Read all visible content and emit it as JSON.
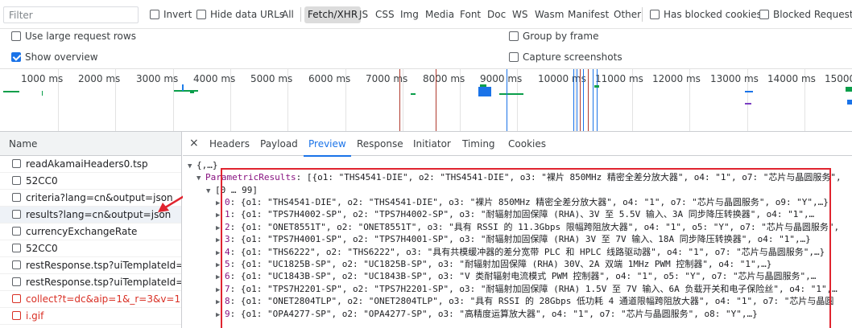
{
  "filter": {
    "placeholder": "Filter",
    "invert_label": "Invert",
    "hide_data_urls_label": "Hide data URLs",
    "types": [
      "All",
      "Fetch/XHR",
      "JS",
      "CSS",
      "Img",
      "Media",
      "Font",
      "Doc",
      "WS",
      "Wasm",
      "Manifest",
      "Other"
    ],
    "active_type": "Fetch/XHR",
    "has_blocked_cookies_label": "Has blocked cookies",
    "blocked_requests_label": "Blocked Requests"
  },
  "options": {
    "large_rows_label": "Use large request rows",
    "show_overview_label": "Show overview",
    "group_by_frame_label": "Group by frame",
    "capture_screenshots_label": "Capture screenshots"
  },
  "overview": {
    "ticks": [
      "1000 ms",
      "2000 ms",
      "3000 ms",
      "4000 ms",
      "5000 ms",
      "6000 ms",
      "7000 ms",
      "8000 ms",
      "9000 ms",
      "10000 ms",
      "11000 ms",
      "12000 ms",
      "13000 ms",
      "14000 ms",
      "15000 ms",
      "16000"
    ]
  },
  "request_list": {
    "header": "Name",
    "rows": [
      {
        "name": "readAkamaiHeaders0.tsp",
        "error": false
      },
      {
        "name": "52CC0",
        "error": false
      },
      {
        "name": "criteria?lang=cn&output=json",
        "error": false
      },
      {
        "name": "results?lang=cn&output=json",
        "error": false
      },
      {
        "name": "currencyExchangeRate",
        "error": false
      },
      {
        "name": "52CC0",
        "error": false
      },
      {
        "name": "restResponse.tsp?uiTemplateId=R...",
        "error": false
      },
      {
        "name": "restResponse.tsp?uiTemplateId=R...",
        "error": false
      },
      {
        "name": "collect?t=dc&aip=1&_r=3&v=1&...",
        "error": true
      },
      {
        "name": "i.gif",
        "error": true
      }
    ]
  },
  "details": {
    "close_label": "×",
    "tabs": [
      "Headers",
      "Payload",
      "Preview",
      "Response",
      "Initiator",
      "Timing",
      "Cookies"
    ],
    "active_tab": "Preview",
    "preview": {
      "root": "{,…}",
      "param_key": "ParametricResults",
      "param_summary": ": [{o1: \"THS4541-DIE\", o2: \"THS4541-DIE\", o3: \"裸片 850MHz 精密全差分放大器\", o4: \"1\", o7: \"芯片与晶圆服务\",",
      "range": "[0 … 99]",
      "items": [
        {
          "i": "0",
          "text": ": {o1: \"THS4541-DIE\", o2: \"THS4541-DIE\", o3: \"裸片 850MHz 精密全差分放大器\", o4: \"1\", o7: \"芯片与晶圆服务\", o9: \"Y\",…}"
        },
        {
          "i": "1",
          "text": ": {o1: \"TPS7H4002-SP\", o2: \"TPS7H4002-SP\", o3: \"耐辐射加固保障 (RHA)、3V 至 5.5V 输入、3A 同步降压转换器\", o4: \"1\",…"
        },
        {
          "i": "2",
          "text": ": {o1: \"ONET8551T\", o2: \"ONET8551T\", o3: \"具有 RSSI 的 11.3Gbps 限幅跨阻放大器\", o4: \"1\", o5: \"Y\", o7: \"芯片与晶圆服务\","
        },
        {
          "i": "3",
          "text": ": {o1: \"TPS7H4001-SP\", o2: \"TPS7H4001-SP\", o3: \"耐辐射加固保障 (RHA) 3V 至 7V 输入、18A 同步降压转换器\", o4: \"1\",…}"
        },
        {
          "i": "4",
          "text": ": {o1: \"THS6222\", o2: \"THS6222\", o3: \"具有共模缓冲器的差分宽带 PLC 和 HPLC 线路驱动器\", o4: \"1\", o7: \"芯片与晶圆服务\",…}"
        },
        {
          "i": "5",
          "text": ": {o1: \"UC1825B-SP\", o2: \"UC1825B-SP\", o3: \"耐辐射加固保障 (RHA) 30V、2A 双端 1MHz PWM 控制器\", o4: \"1\",…}"
        },
        {
          "i": "6",
          "text": ": {o1: \"UC1843B-SP\", o2: \"UC1843B-SP\", o3: \"V 类耐辐射电流模式 PWM 控制器\", o4: \"1\", o5: \"Y\", o7: \"芯片与晶圆服务\",…"
        },
        {
          "i": "7",
          "text": ": {o1: \"TPS7H2201-SP\", o2: \"TPS7H2201-SP\", o3: \"耐辐射加固保障 (RHA) 1.5V 至 7V 输入、6A 负载开关和电子保险丝\", o4: \"1\",…"
        },
        {
          "i": "8",
          "text": ": {o1: \"ONET2804TLP\", o2: \"ONET2804TLP\", o3: \"具有 RSSI 的 28Gbps 低功耗 4 通道限幅跨阻放大器\", o4: \"1\", o7: \"芯片与晶圆"
        },
        {
          "i": "9",
          "text": ": {o1: \"OPA4277-SP\", o2: \"OPA4277-SP\", o3: \"高精度运算放大器\", o4: \"1\", o7: \"芯片与晶圆服务\", o8: \"Y\",…}"
        }
      ]
    }
  },
  "colors": {
    "accent": "#1a73e8",
    "error_text": "#d93025",
    "annotation_red": "#e0242f"
  }
}
